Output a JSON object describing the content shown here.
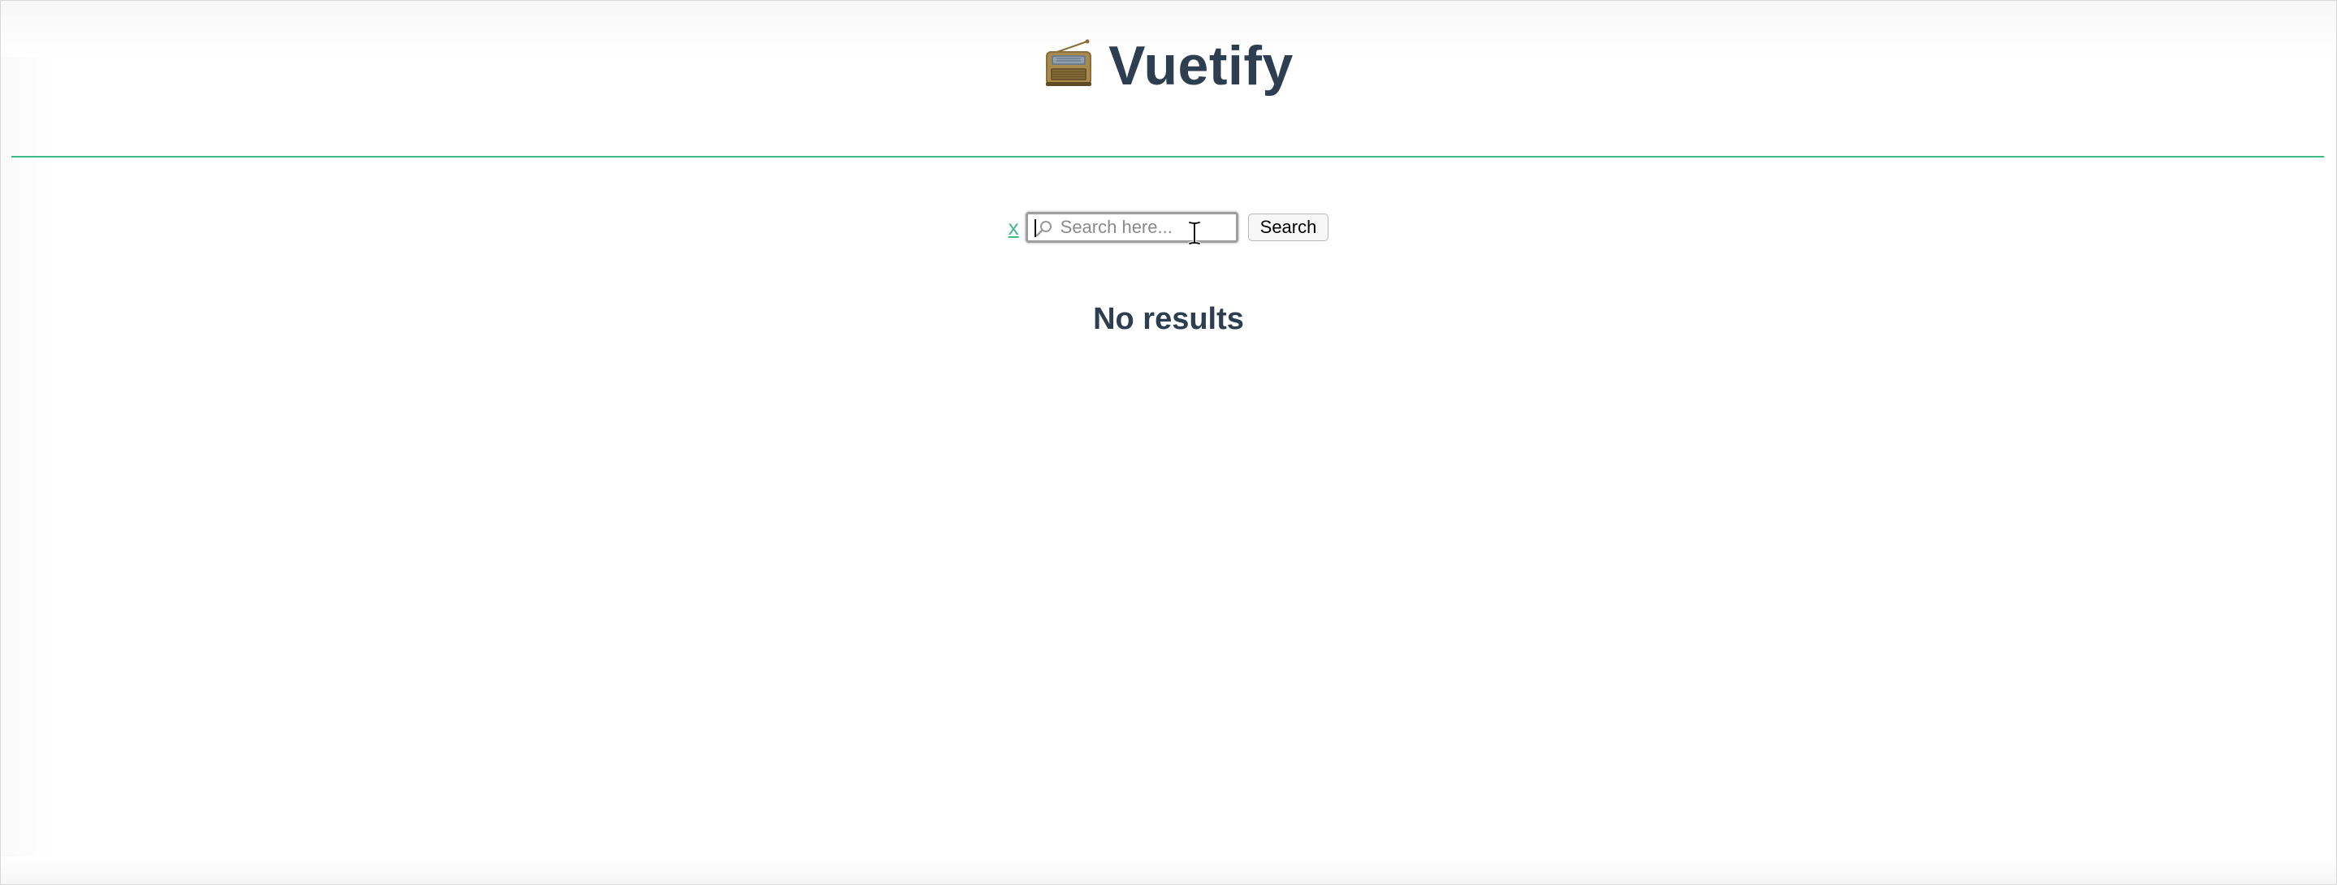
{
  "header": {
    "title": "Vuetify",
    "logo_icon": "radio-icon"
  },
  "search": {
    "clear_label": "x",
    "placeholder": "Search here...",
    "value": "",
    "button_label": "Search",
    "icon": "search-icon"
  },
  "results": {
    "empty_message": "No results"
  },
  "colors": {
    "accent": "#42b983",
    "text": "#2c3e50"
  }
}
